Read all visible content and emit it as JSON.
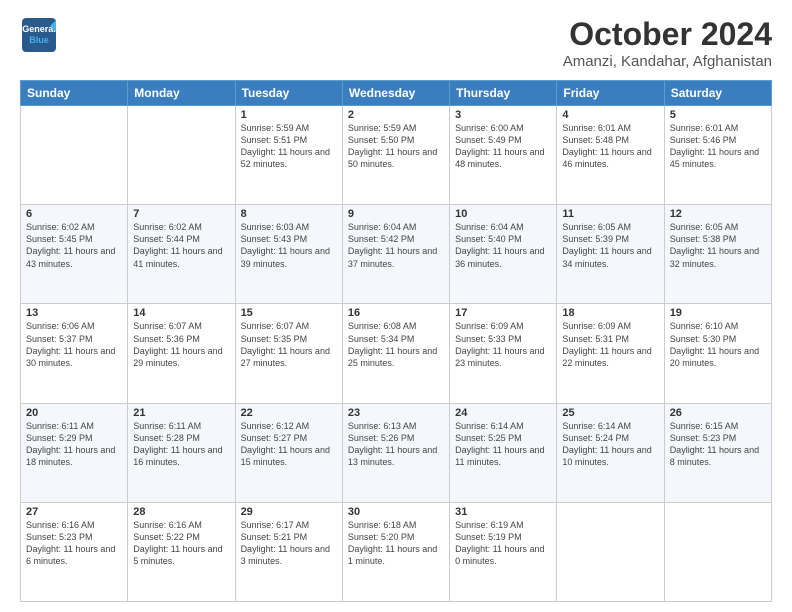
{
  "header": {
    "logo_line1": "General",
    "logo_line2": "Blue",
    "month": "October 2024",
    "location": "Amanzi, Kandahar, Afghanistan"
  },
  "days_of_week": [
    "Sunday",
    "Monday",
    "Tuesday",
    "Wednesday",
    "Thursday",
    "Friday",
    "Saturday"
  ],
  "weeks": [
    [
      {
        "day": "",
        "info": ""
      },
      {
        "day": "",
        "info": ""
      },
      {
        "day": "1",
        "info": "Sunrise: 5:59 AM\nSunset: 5:51 PM\nDaylight: 11 hours and 52 minutes."
      },
      {
        "day": "2",
        "info": "Sunrise: 5:59 AM\nSunset: 5:50 PM\nDaylight: 11 hours and 50 minutes."
      },
      {
        "day": "3",
        "info": "Sunrise: 6:00 AM\nSunset: 5:49 PM\nDaylight: 11 hours and 48 minutes."
      },
      {
        "day": "4",
        "info": "Sunrise: 6:01 AM\nSunset: 5:48 PM\nDaylight: 11 hours and 46 minutes."
      },
      {
        "day": "5",
        "info": "Sunrise: 6:01 AM\nSunset: 5:46 PM\nDaylight: 11 hours and 45 minutes."
      }
    ],
    [
      {
        "day": "6",
        "info": "Sunrise: 6:02 AM\nSunset: 5:45 PM\nDaylight: 11 hours and 43 minutes."
      },
      {
        "day": "7",
        "info": "Sunrise: 6:02 AM\nSunset: 5:44 PM\nDaylight: 11 hours and 41 minutes."
      },
      {
        "day": "8",
        "info": "Sunrise: 6:03 AM\nSunset: 5:43 PM\nDaylight: 11 hours and 39 minutes."
      },
      {
        "day": "9",
        "info": "Sunrise: 6:04 AM\nSunset: 5:42 PM\nDaylight: 11 hours and 37 minutes."
      },
      {
        "day": "10",
        "info": "Sunrise: 6:04 AM\nSunset: 5:40 PM\nDaylight: 11 hours and 36 minutes."
      },
      {
        "day": "11",
        "info": "Sunrise: 6:05 AM\nSunset: 5:39 PM\nDaylight: 11 hours and 34 minutes."
      },
      {
        "day": "12",
        "info": "Sunrise: 6:05 AM\nSunset: 5:38 PM\nDaylight: 11 hours and 32 minutes."
      }
    ],
    [
      {
        "day": "13",
        "info": "Sunrise: 6:06 AM\nSunset: 5:37 PM\nDaylight: 11 hours and 30 minutes."
      },
      {
        "day": "14",
        "info": "Sunrise: 6:07 AM\nSunset: 5:36 PM\nDaylight: 11 hours and 29 minutes."
      },
      {
        "day": "15",
        "info": "Sunrise: 6:07 AM\nSunset: 5:35 PM\nDaylight: 11 hours and 27 minutes."
      },
      {
        "day": "16",
        "info": "Sunrise: 6:08 AM\nSunset: 5:34 PM\nDaylight: 11 hours and 25 minutes."
      },
      {
        "day": "17",
        "info": "Sunrise: 6:09 AM\nSunset: 5:33 PM\nDaylight: 11 hours and 23 minutes."
      },
      {
        "day": "18",
        "info": "Sunrise: 6:09 AM\nSunset: 5:31 PM\nDaylight: 11 hours and 22 minutes."
      },
      {
        "day": "19",
        "info": "Sunrise: 6:10 AM\nSunset: 5:30 PM\nDaylight: 11 hours and 20 minutes."
      }
    ],
    [
      {
        "day": "20",
        "info": "Sunrise: 6:11 AM\nSunset: 5:29 PM\nDaylight: 11 hours and 18 minutes."
      },
      {
        "day": "21",
        "info": "Sunrise: 6:11 AM\nSunset: 5:28 PM\nDaylight: 11 hours and 16 minutes."
      },
      {
        "day": "22",
        "info": "Sunrise: 6:12 AM\nSunset: 5:27 PM\nDaylight: 11 hours and 15 minutes."
      },
      {
        "day": "23",
        "info": "Sunrise: 6:13 AM\nSunset: 5:26 PM\nDaylight: 11 hours and 13 minutes."
      },
      {
        "day": "24",
        "info": "Sunrise: 6:14 AM\nSunset: 5:25 PM\nDaylight: 11 hours and 11 minutes."
      },
      {
        "day": "25",
        "info": "Sunrise: 6:14 AM\nSunset: 5:24 PM\nDaylight: 11 hours and 10 minutes."
      },
      {
        "day": "26",
        "info": "Sunrise: 6:15 AM\nSunset: 5:23 PM\nDaylight: 11 hours and 8 minutes."
      }
    ],
    [
      {
        "day": "27",
        "info": "Sunrise: 6:16 AM\nSunset: 5:23 PM\nDaylight: 11 hours and 6 minutes."
      },
      {
        "day": "28",
        "info": "Sunrise: 6:16 AM\nSunset: 5:22 PM\nDaylight: 11 hours and 5 minutes."
      },
      {
        "day": "29",
        "info": "Sunrise: 6:17 AM\nSunset: 5:21 PM\nDaylight: 11 hours and 3 minutes."
      },
      {
        "day": "30",
        "info": "Sunrise: 6:18 AM\nSunset: 5:20 PM\nDaylight: 11 hours and 1 minute."
      },
      {
        "day": "31",
        "info": "Sunrise: 6:19 AM\nSunset: 5:19 PM\nDaylight: 11 hours and 0 minutes."
      },
      {
        "day": "",
        "info": ""
      },
      {
        "day": "",
        "info": ""
      }
    ]
  ]
}
